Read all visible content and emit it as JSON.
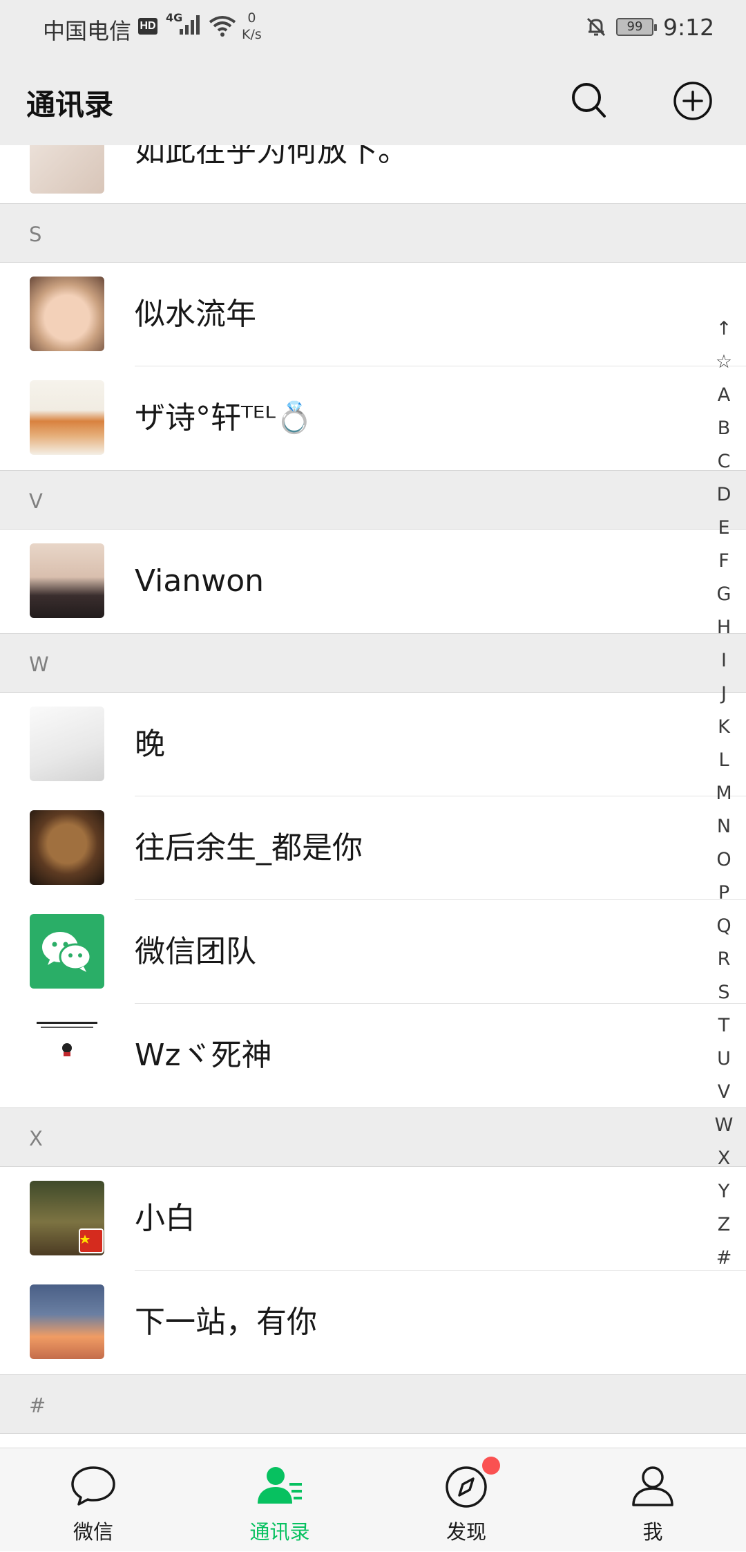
{
  "status_bar": {
    "carrier": "中国电信",
    "hd": "HD",
    "network": "4G",
    "speed_value": "0",
    "speed_unit": "K/s",
    "battery": "99",
    "time": "9:12"
  },
  "header": {
    "title": "通讯录",
    "search_icon": "search-icon",
    "add_icon": "add-circle-icon"
  },
  "contacts_top": {
    "partial_name": "如此在乎为何放下。"
  },
  "sections": [
    {
      "letter": "S",
      "contacts": [
        {
          "name": "似水流年"
        },
        {
          "name": "ザ诗°轩ᵀᴱᴸ💍"
        }
      ]
    },
    {
      "letter": "V",
      "contacts": [
        {
          "name": "Vianwon"
        }
      ]
    },
    {
      "letter": "W",
      "contacts": [
        {
          "name": "晚"
        },
        {
          "name": "往后余生_都是你"
        },
        {
          "name": "微信团队"
        },
        {
          "name": "Wzヾ死神"
        }
      ]
    },
    {
      "letter": "X",
      "contacts": [
        {
          "name": "小白"
        },
        {
          "name": "下一站，有你"
        }
      ]
    },
    {
      "letter": "#"
    }
  ],
  "index_bar": [
    "↑",
    "☆",
    "A",
    "B",
    "C",
    "D",
    "E",
    "F",
    "G",
    "H",
    "I",
    "J",
    "K",
    "L",
    "M",
    "N",
    "O",
    "P",
    "Q",
    "R",
    "S",
    "T",
    "U",
    "V",
    "W",
    "X",
    "Y",
    "Z",
    "#"
  ],
  "tabs": [
    {
      "label": "微信",
      "icon": "chat-bubble-icon",
      "active": false
    },
    {
      "label": "通讯录",
      "icon": "contacts-icon",
      "active": true
    },
    {
      "label": "发现",
      "icon": "compass-icon",
      "active": false,
      "badge": "dot"
    },
    {
      "label": "我",
      "icon": "person-icon",
      "active": false
    }
  ],
  "colors": {
    "accent": "#07c160",
    "badge": "#fa5151",
    "header_bg": "#ededed",
    "section_bg": "#ededed"
  }
}
